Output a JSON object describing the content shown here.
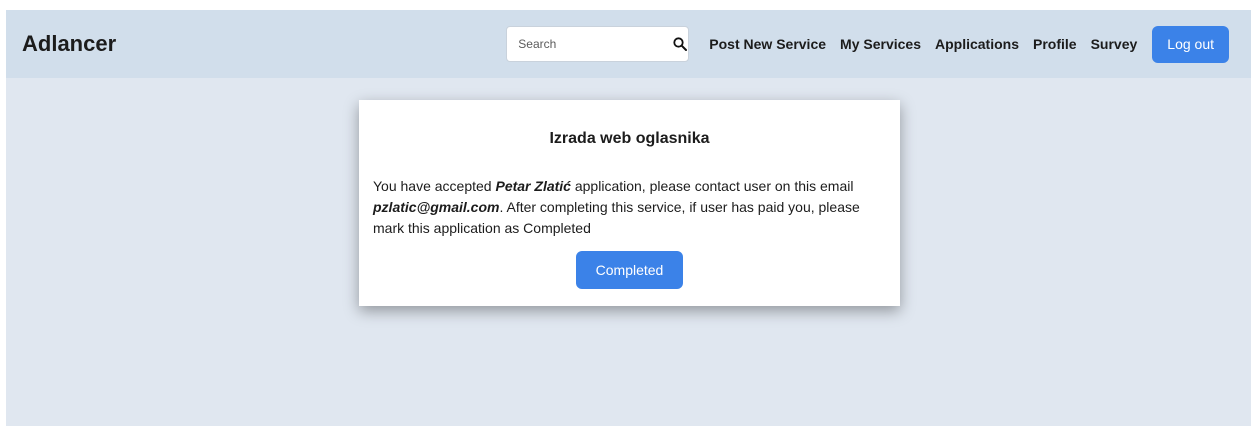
{
  "navbar": {
    "brand": "Adlancer",
    "search": {
      "placeholder": "Search",
      "value": "",
      "icon": "search-icon"
    },
    "links": [
      "Post New Service",
      "My Services",
      "Applications",
      "Profile",
      "Survey"
    ],
    "logout_label": "Log out"
  },
  "card": {
    "title": "Izrada web oglasnika",
    "text_1": "You have accepted ",
    "applicant": "Petar Zlatić",
    "text_2": " application, please contact user on this email ",
    "email": "pzlatic@gmail.com",
    "text_3": ". After completing this service, if user has paid you, please mark this application as Completed",
    "button_label": "Completed"
  },
  "colors": {
    "navbar_bg": "#d1deeb",
    "page_bg": "#e0e7f0",
    "accent": "#3b82e8"
  }
}
